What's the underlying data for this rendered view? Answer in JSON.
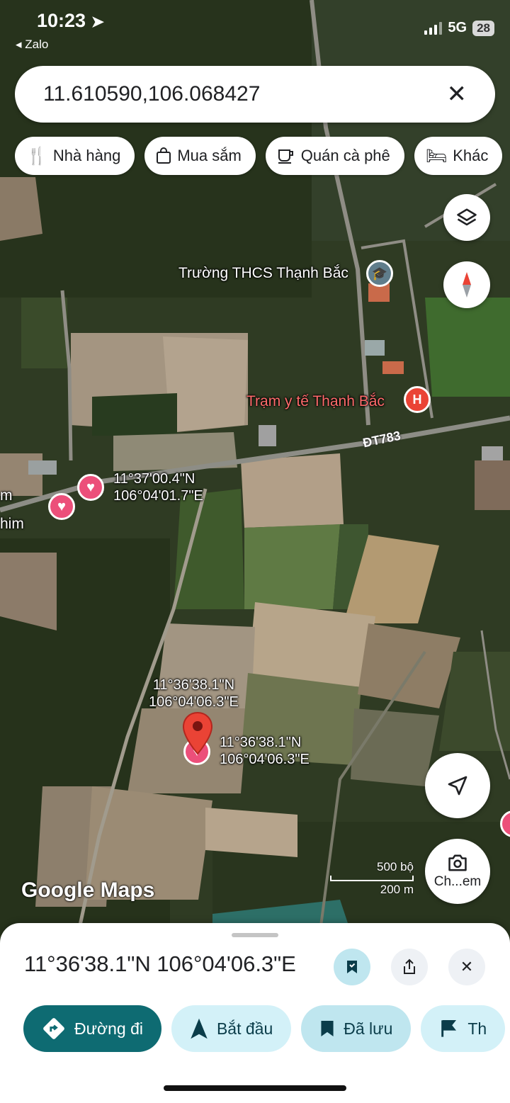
{
  "status_bar": {
    "time": "10:23",
    "back_app": "Zalo",
    "network": "5G",
    "battery": "28"
  },
  "search": {
    "value": "11.610590,106.068427",
    "clear_icon": "close-icon"
  },
  "chips": [
    {
      "label": "Nhà hàng",
      "icon": "restaurant-icon"
    },
    {
      "label": "Mua sắm",
      "icon": "shopping-bag-icon"
    },
    {
      "label": "Quán cà phê",
      "icon": "coffee-icon"
    },
    {
      "label": "Khác",
      "icon": "bed-icon"
    }
  ],
  "map": {
    "labels": {
      "school": "Trường THCS Thạnh Bắc",
      "clinic": "Trạm y tế Thạnh Bắc",
      "road": "ĐT783",
      "edge_top": "m",
      "edge_bottom": "him"
    },
    "saved_pin_1": {
      "lat": "11°37'00.4\"N",
      "lng": "106°04'01.7\"E"
    },
    "marker_above": {
      "lat": "11°36'38.1\"N",
      "lng": "106°04'06.3\"E"
    },
    "marker_right": {
      "lat": "11°36'38.1\"N",
      "lng": "106°04'06.3\"E"
    },
    "logo": "Google Maps",
    "scale": {
      "imperial": "500 bộ",
      "metric": "200 m"
    },
    "camera_label": "Ch...em"
  },
  "sheet": {
    "title": "11°36'38.1\"N 106°04'06.3\"E",
    "actions": [
      {
        "label": "Đường đi",
        "icon": "directions-icon"
      },
      {
        "label": "Bắt đầu",
        "icon": "navigation-icon"
      },
      {
        "label": "Đã lưu",
        "icon": "bookmark-icon"
      },
      {
        "label": "Th",
        "icon": "flag-icon"
      }
    ]
  },
  "colors": {
    "primary": "#0e6b72",
    "pin": "#ea4335",
    "saved_heart": "#ec4f7a",
    "clinic": "#ea4335"
  }
}
